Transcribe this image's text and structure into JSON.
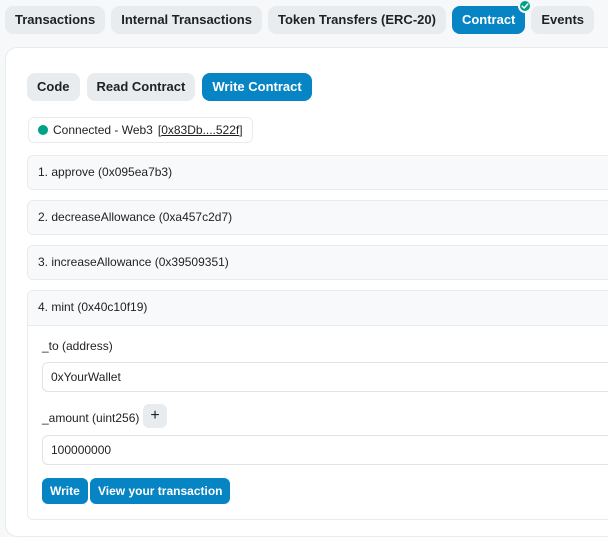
{
  "top_tabs": {
    "transactions": "Transactions",
    "internal_transactions": "Internal Transactions",
    "token_transfers": "Token Transfers (ERC-20)",
    "contract": "Contract",
    "events": "Events"
  },
  "sub_tabs": {
    "code": "Code",
    "read_contract": "Read Contract",
    "write_contract": "Write Contract"
  },
  "connection": {
    "status": "Connected - Web3",
    "address_prefix": "[",
    "address": "0x83Db....522f",
    "address_suffix": "]"
  },
  "functions": [
    {
      "label": "1. approve (0x095ea7b3)"
    },
    {
      "label": "2. decreaseAllowance (0xa457c2d7)"
    },
    {
      "label": "3. increaseAllowance (0x39509351)"
    },
    {
      "label": "4. mint (0x40c10f19)"
    }
  ],
  "mint_form": {
    "to_label": "_to (address)",
    "to_value": "0xYourWallet",
    "amount_label": "_amount (uint256)",
    "plus": "+",
    "amount_value": "100000000",
    "write_button": "Write",
    "view_tx_button": "View your transaction"
  },
  "colors": {
    "accent": "#0784c3",
    "success": "#00a186",
    "pill_bg": "#e9ecef"
  }
}
